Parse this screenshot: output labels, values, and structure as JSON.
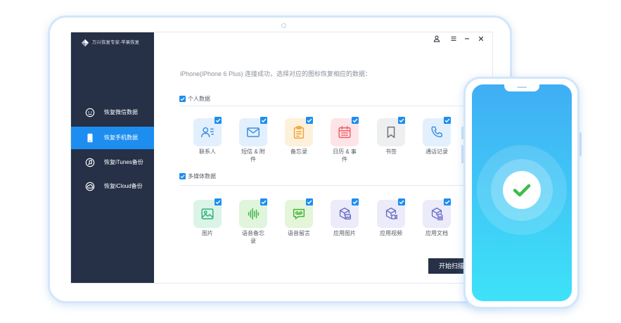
{
  "app": {
    "title": "万兴恢复专家-苹果恢复",
    "logo_icon": "diamond-logo-icon"
  },
  "window_controls": [
    {
      "icon": "user-icon"
    },
    {
      "icon": "menu-icon"
    },
    {
      "icon": "minimize-icon"
    },
    {
      "icon": "close-icon"
    }
  ],
  "sidebar": {
    "items": [
      {
        "label": "恢复微信数据",
        "icon": "wechat-icon",
        "active": false
      },
      {
        "label": "恢复手机数据",
        "icon": "phone-icon",
        "active": true
      },
      {
        "label": "恢复iTunes备份",
        "icon": "itunes-icon",
        "active": false
      },
      {
        "label": "恢复iCloud备份",
        "icon": "icloud-icon",
        "active": false
      }
    ]
  },
  "main": {
    "instruction": "iPhone(iPhone 6 Plus) 连接成功，选择对应的图标恢复相应的数据：",
    "sections": [
      {
        "label": "个人数据",
        "checked": true,
        "items": [
          {
            "label": "联系人",
            "icon": "contacts-icon",
            "checked": true,
            "bg": "#e2f0fd",
            "fg": "#3c8fe3"
          },
          {
            "label": "短信 & 附件",
            "icon": "message-icon",
            "checked": true,
            "bg": "#e2f0fd",
            "fg": "#3c8fe3"
          },
          {
            "label": "备忘录",
            "icon": "notes-icon",
            "checked": true,
            "bg": "#fdf1dc",
            "fg": "#f0a236"
          },
          {
            "label": "日历 & 事件",
            "icon": "calendar-icon",
            "checked": true,
            "bg": "#fde4e6",
            "fg": "#ef5f68"
          },
          {
            "label": "书签",
            "icon": "bookmark-icon",
            "checked": true,
            "bg": "#eeeff1",
            "fg": "#6e7178"
          },
          {
            "label": "通话记录",
            "icon": "call-log-icon",
            "checked": true,
            "bg": "#e2f0fd",
            "fg": "#3c8fe3"
          }
        ]
      },
      {
        "label": "多媒体数据",
        "checked": true,
        "items": [
          {
            "label": "图片",
            "icon": "photo-icon",
            "checked": true,
            "bg": "#dcf4e8",
            "fg": "#2bb37a"
          },
          {
            "label": "语音备忘录",
            "icon": "voice-memo-icon",
            "checked": true,
            "bg": "#e0f5dc",
            "fg": "#3fb648"
          },
          {
            "label": "语音留言",
            "icon": "voicemail-icon",
            "checked": true,
            "bg": "#e4f5da",
            "fg": "#48b53c"
          },
          {
            "label": "应用图片",
            "icon": "app-photo-icon",
            "checked": true,
            "bg": "#ebebf9",
            "fg": "#6c6cc9"
          },
          {
            "label": "应用视频",
            "icon": "app-video-icon",
            "checked": true,
            "bg": "#ebebf9",
            "fg": "#6c6cc9"
          },
          {
            "label": "应用文档",
            "icon": "app-document-icon",
            "checked": true,
            "bg": "#ebebf9",
            "fg": "#6c6cc9"
          }
        ]
      }
    ],
    "scan_button": "开始扫描"
  },
  "phone": {
    "status_icon": "check-icon"
  },
  "colors": {
    "sidebar_bg": "#263047",
    "accent": "#1d8ef0",
    "button_bg": "#263047",
    "success": "#3cbe4a",
    "phone_screen_top": "#40aef4",
    "phone_screen_bottom": "#3ee2f8"
  }
}
